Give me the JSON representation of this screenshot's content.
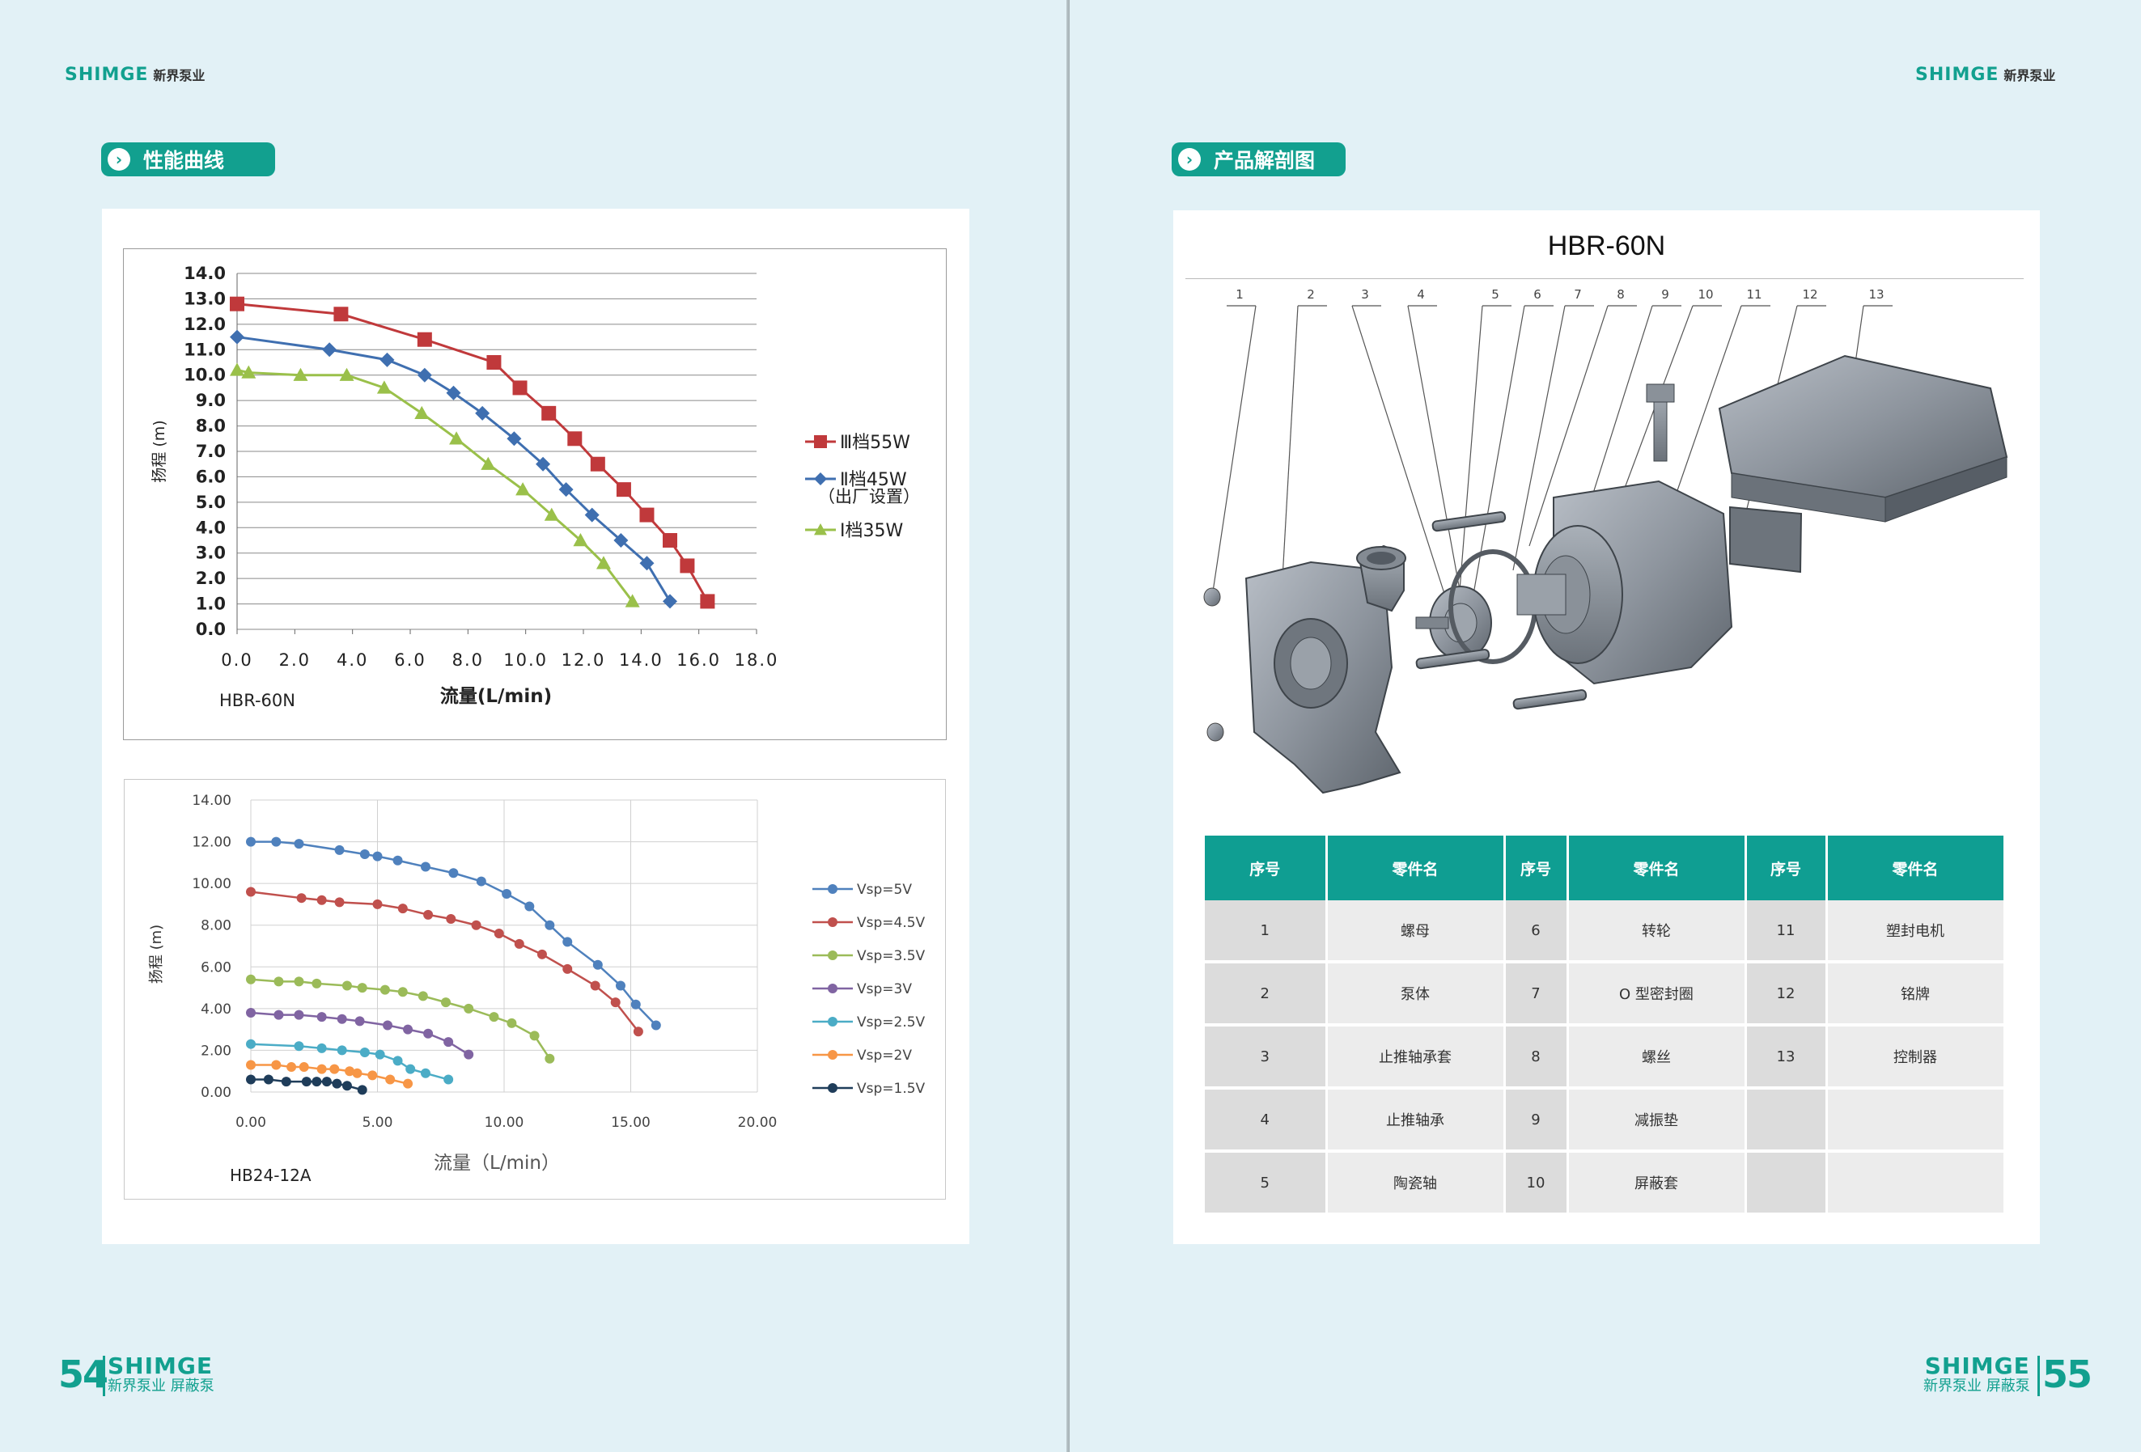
{
  "left_page": {
    "brand": {
      "name": "SHIMGE",
      "cn": "新界泵业"
    },
    "section_label": "性能曲线",
    "footer": {
      "page_number": "54",
      "brand": "SHIMGE",
      "sub": "新界泵业 屏蔽泵"
    }
  },
  "right_page": {
    "brand": {
      "name": "SHIMGE",
      "cn": "新界泵业"
    },
    "section_label": "产品解剖图",
    "diagram_title": "HBR-60N",
    "callouts": [
      "1",
      "2",
      "3",
      "4",
      "5",
      "6",
      "7",
      "8",
      "9",
      "10",
      "11",
      "12",
      "13"
    ],
    "table": {
      "headers": [
        "序号",
        "零件名",
        "序号",
        "零件名",
        "序号",
        "零件名"
      ],
      "rows": [
        [
          "1",
          "螺母",
          "6",
          "转轮",
          "11",
          "塑封电机"
        ],
        [
          "2",
          "泵体",
          "7",
          "O 型密封圈",
          "12",
          "铭牌"
        ],
        [
          "3",
          "止推轴承套",
          "8",
          "螺丝",
          "13",
          "控制器"
        ],
        [
          "4",
          "止推轴承",
          "9",
          "减振垫",
          "",
          ""
        ],
        [
          "5",
          "陶瓷轴",
          "10",
          "屏蔽套",
          "",
          ""
        ]
      ]
    },
    "footer": {
      "page_number": "55",
      "brand": "SHIMGE",
      "sub": "新界泵业 屏蔽泵"
    }
  },
  "chart_data": [
    {
      "type": "line",
      "model_label": "HBR-60N",
      "xlabel": "流量(L/min)",
      "ylabel": "扬程 (m)",
      "xlim": [
        0,
        18
      ],
      "ylim": [
        0,
        14
      ],
      "x_ticks": [
        "0.0",
        "2.0",
        "4.0",
        "6.0",
        "8.0",
        "10.0",
        "12.0",
        "14.0",
        "16.0",
        "18.0"
      ],
      "y_ticks": [
        "0.0",
        "1.0",
        "2.0",
        "3.0",
        "4.0",
        "5.0",
        "6.0",
        "7.0",
        "8.0",
        "9.0",
        "10.0",
        "11.0",
        "12.0",
        "13.0",
        "14.0"
      ],
      "grid": true,
      "legend_position": "right",
      "series": [
        {
          "name": "Ⅲ档55W",
          "color": "#c0393b",
          "marker": "square",
          "x": [
            0.0,
            3.6,
            6.5,
            8.9,
            9.8,
            10.8,
            11.7,
            12.5,
            13.4,
            14.2,
            15.0,
            15.6,
            16.3
          ],
          "y": [
            12.8,
            12.4,
            11.4,
            10.5,
            9.5,
            8.5,
            7.5,
            6.5,
            5.5,
            4.5,
            3.5,
            2.5,
            1.1
          ]
        },
        {
          "name": "Ⅱ档45W",
          "color": "#3f6fb0",
          "marker": "diamond",
          "x": [
            0.0,
            3.2,
            5.2,
            6.5,
            7.5,
            8.5,
            9.6,
            10.6,
            11.4,
            12.3,
            13.3,
            14.2,
            15.0
          ],
          "y": [
            11.5,
            11.0,
            10.6,
            10.0,
            9.3,
            8.5,
            7.5,
            6.5,
            5.5,
            4.5,
            3.5,
            2.6,
            1.1
          ]
        },
        {
          "name": "Ⅰ档35W",
          "color": "#9ac04a",
          "marker": "triangle",
          "x": [
            0.0,
            0.4,
            2.2,
            3.8,
            5.1,
            6.4,
            7.6,
            8.7,
            9.9,
            10.9,
            11.9,
            12.7,
            13.7
          ],
          "y": [
            10.2,
            10.1,
            10.0,
            10.0,
            9.5,
            8.5,
            7.5,
            6.5,
            5.5,
            4.5,
            3.5,
            2.6,
            1.1
          ]
        }
      ],
      "legend_note": "（出厂设置）"
    },
    {
      "type": "line",
      "model_label": "HB24-12A",
      "xlabel": "流量（L/min）",
      "ylabel": "扬程 (m)",
      "xlim": [
        0,
        20
      ],
      "ylim": [
        0,
        14
      ],
      "x_ticks": [
        "0.00",
        "5.00",
        "10.00",
        "15.00",
        "20.00"
      ],
      "y_ticks": [
        "0.00",
        "2.00",
        "4.00",
        "6.00",
        "8.00",
        "10.00",
        "12.00",
        "14.00"
      ],
      "grid": true,
      "legend_position": "right",
      "series": [
        {
          "name": "Vsp=5V",
          "color": "#4f81bd",
          "x": [
            0.0,
            1.0,
            1.9,
            3.5,
            4.5,
            5.0,
            5.8,
            6.9,
            8.0,
            9.1,
            10.1,
            11.0,
            11.8,
            12.5,
            13.7,
            14.6,
            15.2,
            16.0
          ],
          "y": [
            12.0,
            12.0,
            11.9,
            11.6,
            11.4,
            11.3,
            11.1,
            10.8,
            10.5,
            10.1,
            9.5,
            8.9,
            8.0,
            7.2,
            6.1,
            5.1,
            4.2,
            3.2
          ]
        },
        {
          "name": "Vsp=4.5V",
          "color": "#c0504d",
          "x": [
            0.0,
            2.0,
            2.8,
            3.5,
            5.0,
            6.0,
            7.0,
            7.9,
            8.9,
            9.8,
            10.6,
            11.5,
            12.5,
            13.6,
            14.4,
            15.3
          ],
          "y": [
            9.6,
            9.3,
            9.2,
            9.1,
            9.0,
            8.8,
            8.5,
            8.3,
            8.0,
            7.6,
            7.1,
            6.6,
            5.9,
            5.1,
            4.3,
            2.9
          ]
        },
        {
          "name": "Vsp=3.5V",
          "color": "#9bbb59",
          "x": [
            0.0,
            1.1,
            1.9,
            2.6,
            3.8,
            4.4,
            5.3,
            6.0,
            6.8,
            7.7,
            8.6,
            9.6,
            10.3,
            11.2,
            11.8
          ],
          "y": [
            5.4,
            5.3,
            5.3,
            5.2,
            5.1,
            5.0,
            4.9,
            4.8,
            4.6,
            4.3,
            4.0,
            3.6,
            3.3,
            2.7,
            1.6
          ]
        },
        {
          "name": "Vsp=3V",
          "color": "#8064a2",
          "x": [
            0.0,
            1.1,
            1.9,
            2.8,
            3.6,
            4.3,
            5.4,
            6.2,
            7.0,
            7.8,
            8.6
          ],
          "y": [
            3.8,
            3.7,
            3.7,
            3.6,
            3.5,
            3.4,
            3.2,
            3.0,
            2.8,
            2.4,
            1.8
          ]
        },
        {
          "name": "Vsp=2.5V",
          "color": "#4bacc6",
          "x": [
            0.0,
            1.9,
            2.8,
            3.6,
            4.5,
            5.1,
            5.8,
            6.3,
            6.9,
            7.8
          ],
          "y": [
            2.3,
            2.2,
            2.1,
            2.0,
            1.9,
            1.8,
            1.5,
            1.1,
            0.9,
            0.6
          ]
        },
        {
          "name": "Vsp=2V",
          "color": "#f79646",
          "x": [
            0.0,
            1.0,
            1.6,
            2.1,
            2.8,
            3.3,
            3.9,
            4.2,
            4.8,
            5.5,
            6.2
          ],
          "y": [
            1.3,
            1.3,
            1.2,
            1.2,
            1.1,
            1.1,
            1.0,
            0.9,
            0.8,
            0.6,
            0.4
          ]
        },
        {
          "name": "Vsp=1.5V",
          "color": "#1f3d5a",
          "x": [
            0.0,
            0.7,
            1.4,
            2.2,
            2.6,
            3.0,
            3.4,
            3.8,
            4.4
          ],
          "y": [
            0.6,
            0.6,
            0.5,
            0.5,
            0.5,
            0.5,
            0.4,
            0.3,
            0.1
          ]
        }
      ]
    }
  ]
}
